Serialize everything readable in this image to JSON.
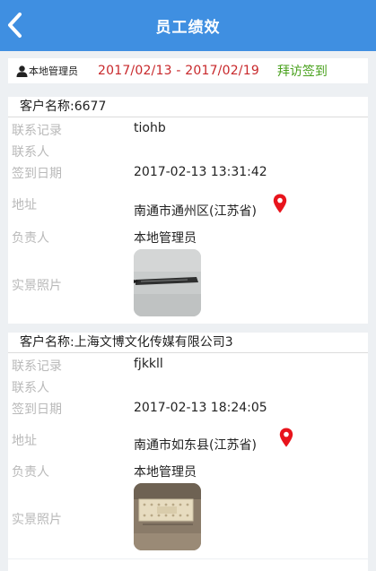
{
  "header": {
    "title": "员工绩效",
    "back_icon": "chevron-left-icon"
  },
  "summary": {
    "user_icon": "user-icon",
    "user": "本地管理员",
    "date_range": "2017/02/13 - 2017/02/19",
    "type": "拜访签到"
  },
  "labels": {
    "contact_record": "联系记录",
    "contact_person": "联系人",
    "checkin_date": "签到日期",
    "address": "地址",
    "manager": "负责人",
    "photo": "实景照片"
  },
  "records": [
    {
      "client": "客户名称:6677",
      "contact_record": "tiohb",
      "contact_person": "",
      "checkin_date": "2017-02-13 13:31:42",
      "address": "南通市通州区(江苏省)",
      "manager": "本地管理员"
    },
    {
      "client": "客户名称:上海文博文化传媒有限公司3",
      "contact_record": "fjkkll",
      "contact_person": "",
      "checkin_date": "2017-02-13 18:24:05",
      "address": "南通市如东县(江苏省)",
      "manager": "本地管理员"
    }
  ],
  "colors": {
    "header_bg": "#3f8fe1",
    "date_range": "#c8282b",
    "type": "#49a11d",
    "pin": "#e8141c",
    "label": "#b9b9b9"
  }
}
